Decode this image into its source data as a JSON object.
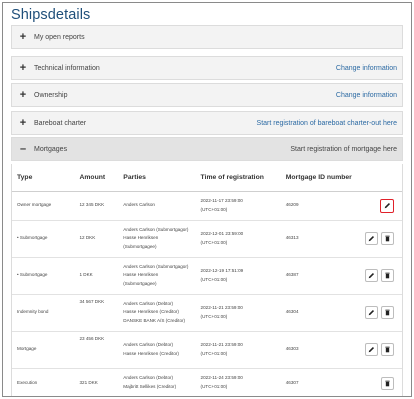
{
  "page_title": "Shipsdetails",
  "panels": [
    {
      "label": "My open reports",
      "link": ""
    },
    {
      "label": "Technical information",
      "link": "Change information"
    },
    {
      "label": "Ownership",
      "link": "Change information"
    },
    {
      "label": "Bareboat charter",
      "link": "Start registration of bareboat charter-out here"
    }
  ],
  "mortgages": {
    "label": "Mortgages",
    "link": "Start registration of mortgage here",
    "columns": [
      "Type",
      "Amount",
      "Parties",
      "Time of registration",
      "Mortgage ID number"
    ],
    "rows": [
      {
        "type": "Owner mortgage",
        "amount": "12 345 DKK",
        "parties": [
          "Anders Carlson"
        ],
        "time": [
          "2022-11-17 23:59:00",
          "(UTC+01:00)"
        ],
        "id": "46209",
        "edit": true,
        "delete": false
      },
      {
        "type": "• Submortgage",
        "amount": "12 DKK",
        "parties": [
          "Anders Carlson (Submortgagor)",
          "Hasse Henriksen",
          "(Submortgagee)"
        ],
        "time": [
          "2022-12-01 23:59:00",
          "(UTC+01:00)"
        ],
        "id": "46313",
        "edit": true,
        "delete": true
      },
      {
        "type": "• Submortgage",
        "amount": "1 DKK",
        "parties": [
          "Anders Carlson (Submortgagor)",
          "Hasse Henriksen",
          "(Submortgagee)"
        ],
        "time": [
          "2022-12-19 17:51:09",
          "(UTC+01:00)"
        ],
        "id": "46387",
        "edit": true,
        "delete": true
      },
      {
        "type": "Indemnity bond",
        "amount": "34 567 DKK",
        "parties": [
          "Anders Carlson (Debtor)",
          "Hasse Henriksen (Creditor)",
          "DANSKE BANK A/S (Creditor)"
        ],
        "time": [
          "2022-11-21 23:59:00",
          "(UTC+01:00)"
        ],
        "id": "46304",
        "edit": true,
        "delete": true
      },
      {
        "type": "Mortgage",
        "amount": "23 456 DKK",
        "parties": [
          "Anders Carlson (Debtor)",
          "Hasse Henriksen (Creditor)"
        ],
        "time": [
          "2022-11-21 23:59:00",
          "(UTC+01:00)"
        ],
        "id": "46303",
        "edit": true,
        "delete": true
      },
      {
        "type": "Execution",
        "amount": "321 DKK",
        "parties": [
          "Anders Carlson (Debtor)",
          "Majbritt Sellikes (Creditor)"
        ],
        "time": [
          "2022-11-24 23:59:00",
          "(UTC+01:00)"
        ],
        "id": "46307",
        "edit": false,
        "delete": true
      }
    ]
  },
  "icons": {
    "edit": "pencil-icon",
    "delete": "trash-icon",
    "expand": "plus-icon",
    "collapse": "minus-icon"
  },
  "colors": {
    "title": "#1f4f7a",
    "link": "#2c6aa3",
    "highlight": "#e0212a",
    "panel_bg": "#f3f3f3"
  }
}
